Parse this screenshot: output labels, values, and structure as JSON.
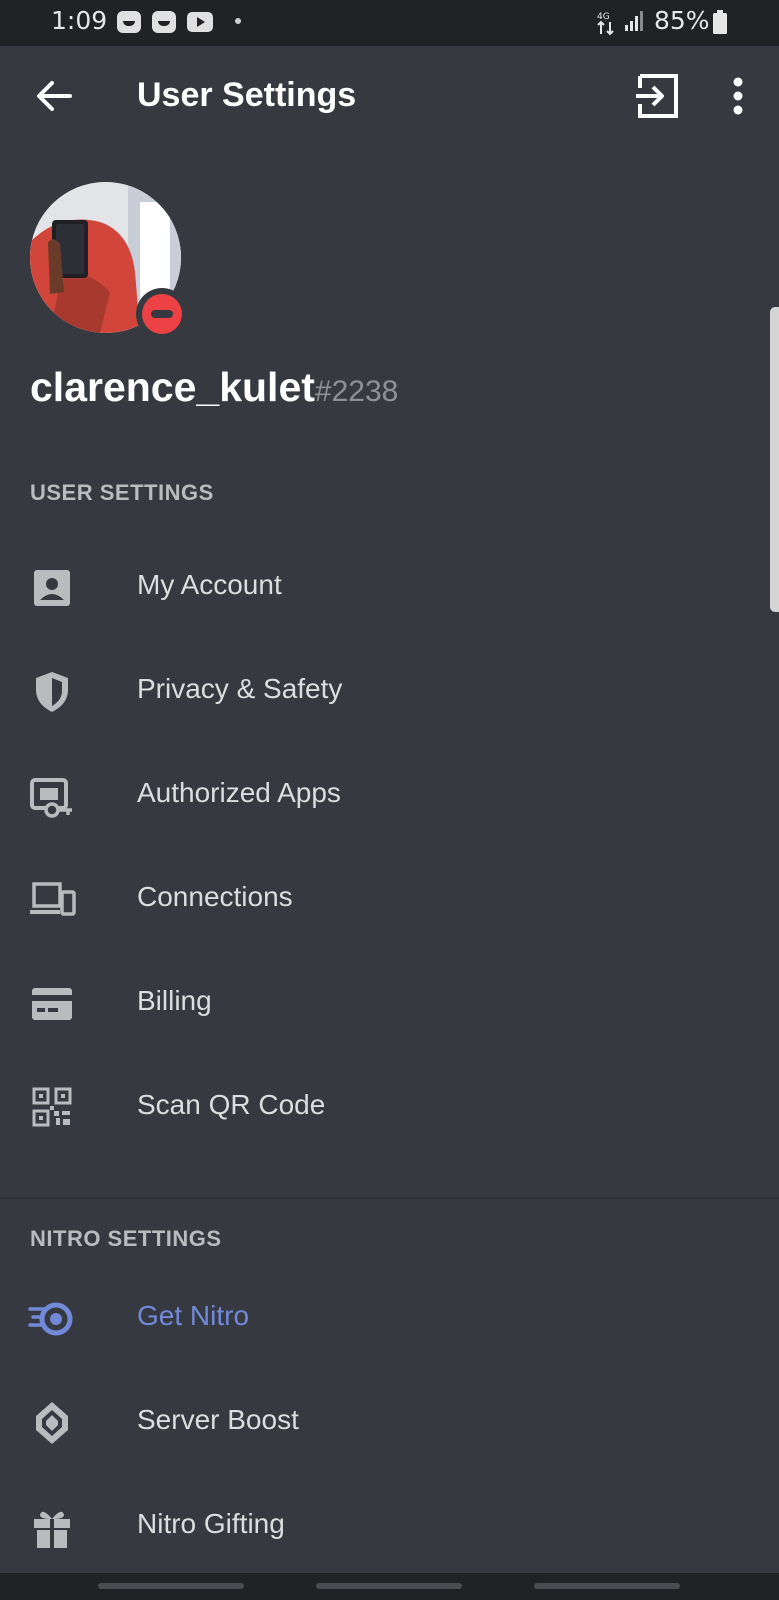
{
  "status_bar": {
    "time": "1:09",
    "battery": "85%",
    "app_icons": [
      "app-notification-icon",
      "app-notification-icon",
      "youtube-icon"
    ],
    "signal_icon": "signal-icon",
    "battery_icon": "battery-icon"
  },
  "app_bar": {
    "title": "User Settings",
    "back_icon": "arrow-left-icon",
    "logout_icon": "logout-icon",
    "more_icon": "more-vertical-icon"
  },
  "profile": {
    "username": "clarence_kulet",
    "discriminator": "#2238",
    "status": "do-not-disturb"
  },
  "sections": {
    "user_settings": {
      "header": "USER SETTINGS",
      "items": [
        {
          "label": "My Account",
          "icon": "account-card-icon"
        },
        {
          "label": "Privacy & Safety",
          "icon": "shield-icon"
        },
        {
          "label": "Authorized Apps",
          "icon": "authorized-apps-icon"
        },
        {
          "label": "Connections",
          "icon": "devices-icon"
        },
        {
          "label": "Billing",
          "icon": "credit-card-icon"
        },
        {
          "label": "Scan QR Code",
          "icon": "qr-code-icon"
        }
      ]
    },
    "nitro_settings": {
      "header": "NITRO SETTINGS",
      "items": [
        {
          "label": "Get Nitro",
          "icon": "nitro-icon"
        },
        {
          "label": "Server Boost",
          "icon": "server-boost-icon"
        },
        {
          "label": "Nitro Gifting",
          "icon": "gift-icon"
        }
      ]
    }
  },
  "colors": {
    "background": "#36393f",
    "status_bar": "#202225",
    "accent_nitro": "#7289da",
    "dnd_red": "#ed4245"
  }
}
